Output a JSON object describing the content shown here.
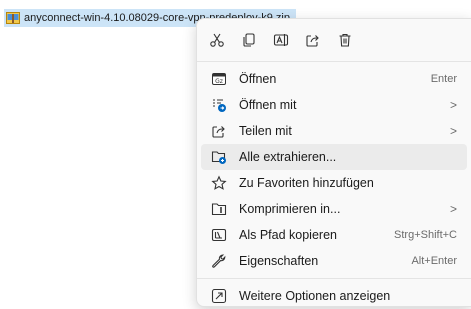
{
  "file": {
    "name": "anyconnect-win-4.10.08029-core-vpn-predeploy-k9.zip",
    "icon": "zip-archive-icon"
  },
  "toolbar": [
    {
      "name": "cut-icon",
      "title": "Ausschneiden"
    },
    {
      "name": "copy-icon",
      "title": "Kopieren"
    },
    {
      "name": "rename-icon",
      "title": "Umbenennen"
    },
    {
      "name": "share-icon",
      "title": "Teilen"
    },
    {
      "name": "delete-icon",
      "title": "Löschen"
    }
  ],
  "menu": {
    "open": {
      "label": "Öffnen",
      "shortcut": "Enter"
    },
    "open_with": {
      "label": "Öffnen mit",
      "chevron": ">"
    },
    "share_with": {
      "label": "Teilen mit",
      "chevron": ">"
    },
    "extract_all": {
      "label": "Alle extrahieren..."
    },
    "favorites": {
      "label": "Zu Favoriten hinzufügen"
    },
    "compress": {
      "label": "Komprimieren in...",
      "chevron": ">"
    },
    "copy_path": {
      "label": "Als Pfad kopieren",
      "shortcut": "Strg+Shift+C"
    },
    "properties": {
      "label": "Eigenschaften",
      "shortcut": "Alt+Enter"
    },
    "more_options": {
      "label": "Weitere Optionen anzeigen"
    }
  },
  "colors": {
    "accent": "#0067c0",
    "highlight": "#ebebeb",
    "selection": "#cce4f7"
  }
}
